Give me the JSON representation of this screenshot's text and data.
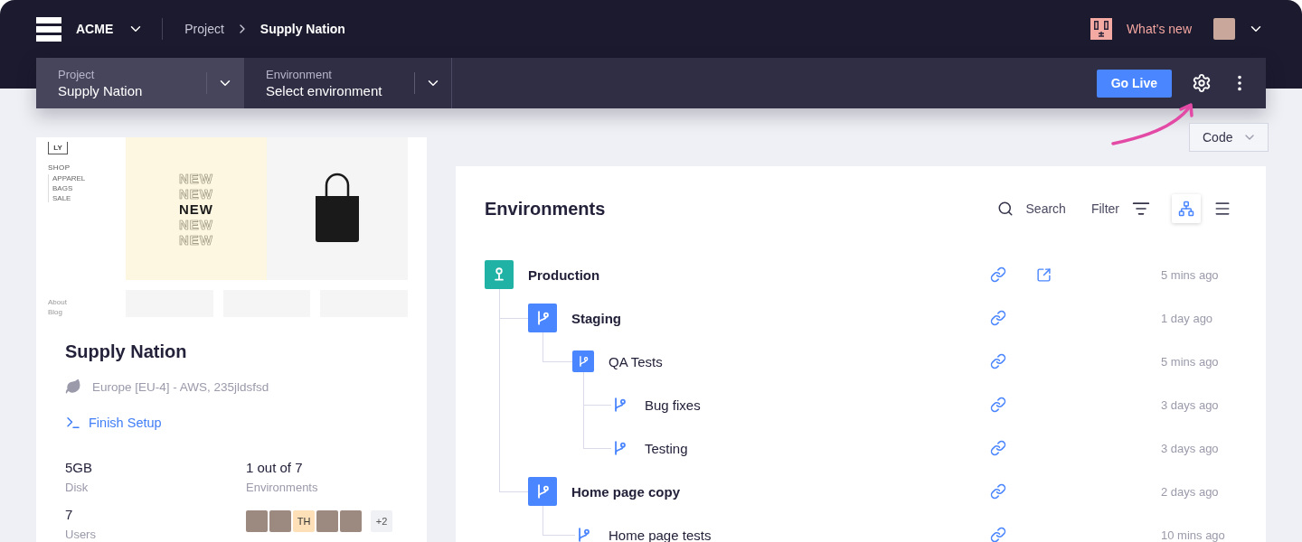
{
  "top_nav": {
    "org": "ACME",
    "breadcrumb": [
      "Project",
      "Supply Nation"
    ],
    "whats_new": "What’s new"
  },
  "toolbar": {
    "selects": [
      {
        "label": "Project",
        "value": "Supply Nation",
        "selected": true
      },
      {
        "label": "Environment",
        "value": "Select environment",
        "selected": false
      }
    ],
    "primary_button": "Go Live"
  },
  "mode_dropdown": "Code",
  "project_card": {
    "preview": {
      "logo": "LY",
      "nav_heading": "SHOP",
      "nav_items": [
        "APPAREL",
        "BAGS",
        "SALE"
      ],
      "banner_lines": [
        {
          "text": "NEW",
          "kind": "outline"
        },
        {
          "text": "NEW",
          "kind": "outline"
        },
        {
          "text": "NEW",
          "kind": "solid"
        },
        {
          "text": "NEW",
          "kind": "outline"
        },
        {
          "text": "NEW",
          "kind": "outline"
        }
      ],
      "footer_links": [
        "About",
        "Blog"
      ]
    },
    "title": "Supply Nation",
    "region": "Europe [EU-4] - AWS, 235jldsfsd",
    "setup_link": "Finish Setup",
    "stats": [
      {
        "value": "5GB",
        "label": "Disk"
      },
      {
        "value": "1 out of 7",
        "label": "Environments"
      },
      {
        "value": "7",
        "label": "Users"
      }
    ],
    "avatars": [
      {
        "kind": "photo"
      },
      {
        "kind": "photo"
      },
      {
        "kind": "initials",
        "initials": "TH"
      },
      {
        "kind": "photo"
      },
      {
        "kind": "photo"
      }
    ],
    "more_users": "+2"
  },
  "environments": {
    "title": "Environments",
    "search": "Search",
    "filter": "Filter",
    "views": [
      {
        "kind": "tree",
        "selected": true
      },
      {
        "kind": "list",
        "selected": false
      }
    ],
    "tree": [
      {
        "name": "Production",
        "kind": "production",
        "time": "5 mins ago",
        "external_link": true,
        "children": [
          {
            "name": "Staging",
            "kind": "branch",
            "time": "1 day ago",
            "external_link": false,
            "children": [
              {
                "name": "QA Tests",
                "kind": "subbranch",
                "time": "5 mins ago",
                "external_link": false,
                "children": [
                  {
                    "name": "Bug fixes",
                    "kind": "leaf",
                    "time": "3 days ago",
                    "external_link": false
                  },
                  {
                    "name": "Testing",
                    "kind": "leaf",
                    "time": "3 days ago",
                    "external_link": false
                  }
                ]
              }
            ]
          },
          {
            "name": "Home page copy",
            "kind": "branch",
            "time": "2 days ago",
            "external_link": false,
            "children": [
              {
                "name": "Home page tests",
                "kind": "leaf",
                "time": "10 mins ago",
                "external_link": false
              }
            ]
          }
        ]
      }
    ]
  }
}
